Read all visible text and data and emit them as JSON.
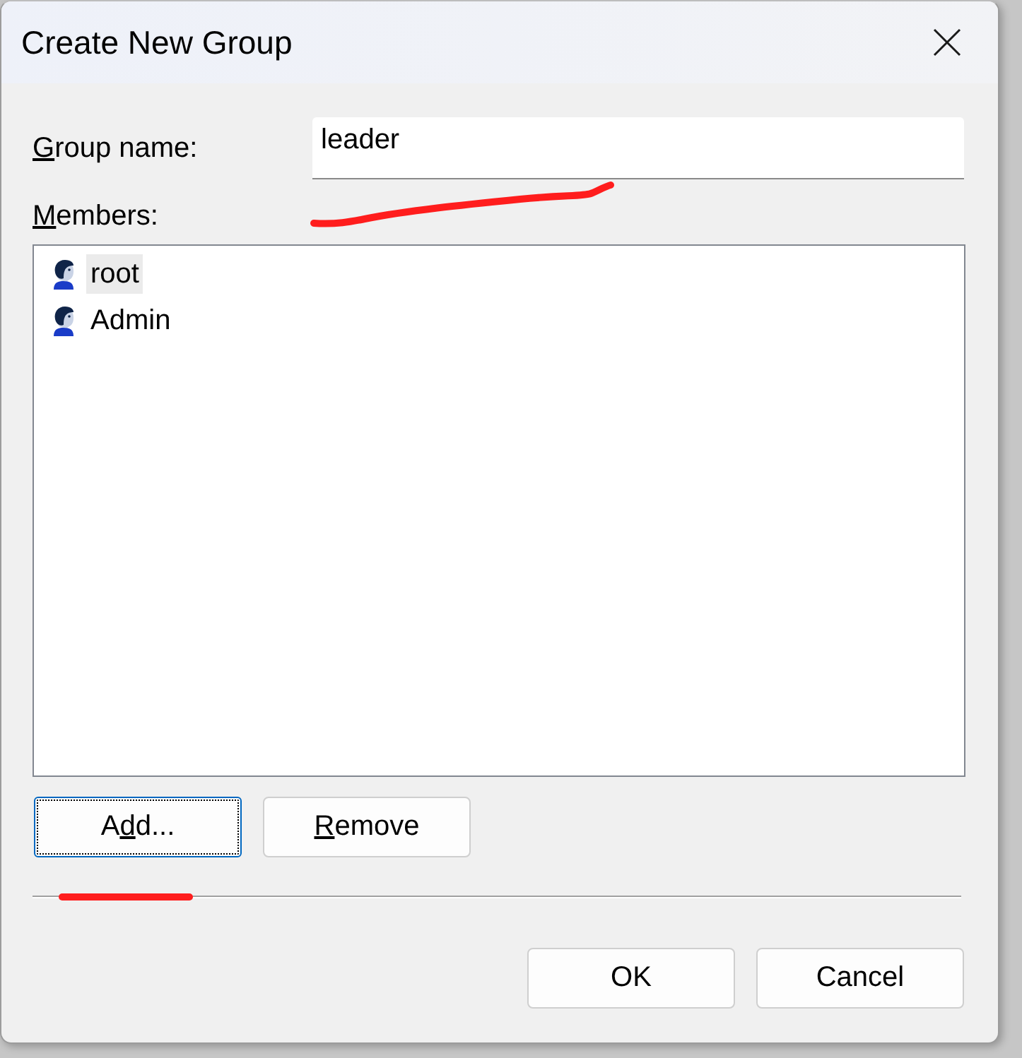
{
  "window": {
    "title": "Create New Group"
  },
  "group_name": {
    "label": [
      {
        "text": "G",
        "access_key": true
      },
      {
        "text": "roup name:",
        "access_key": false
      }
    ],
    "value": "leader"
  },
  "members": {
    "label": [
      {
        "text": "M",
        "access_key": true
      },
      {
        "text": "embers:",
        "access_key": false
      }
    ],
    "items": [
      {
        "name": "root",
        "selected": true
      },
      {
        "name": "Admin",
        "selected": false
      }
    ]
  },
  "member_buttons": [
    {
      "label": [
        {
          "text": "A",
          "access_key": false
        },
        {
          "text": "d",
          "access_key": true
        },
        {
          "text": "d...",
          "access_key": false
        }
      ],
      "focused": true
    },
    {
      "label": [
        {
          "text": "R",
          "access_key": true
        },
        {
          "text": "emove",
          "access_key": false
        }
      ],
      "focused": false
    }
  ],
  "dialog_buttons": [
    {
      "label": [
        {
          "text": "OK",
          "access_key": false
        }
      ],
      "focused": false
    },
    {
      "label": [
        {
          "text": "Cancel",
          "access_key": false
        }
      ],
      "focused": false
    }
  ]
}
